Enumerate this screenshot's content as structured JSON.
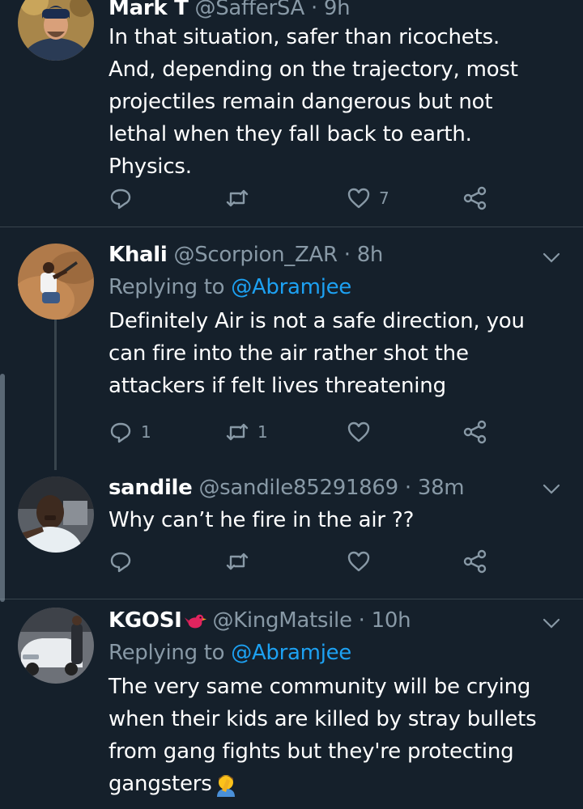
{
  "tweets": [
    {
      "name": "Mark T",
      "handle": "@SafferSA",
      "time": "9h",
      "lines": [
        "In that situation, safer than ricochets.",
        "And, depending on the trajectory, most",
        "projectiles remain dangerous but not",
        "lethal when they fall back to earth.",
        "Physics."
      ],
      "replies": "",
      "retweets": "",
      "likes": "7"
    },
    {
      "name": "Khali",
      "handle": "@Scorpion_ZAR",
      "time": "8h",
      "replying_label": "Replying to",
      "replying_to": "@Abramjee",
      "lines": [
        "Definitely Air is not a safe direction, you",
        "can fire into the air rather shot the",
        "attackers if felt lives threatening"
      ],
      "replies": "1",
      "retweets": "1",
      "likes": ""
    },
    {
      "name": "sandile",
      "handle": "@sandile85291869",
      "time": "38m",
      "lines": [
        "Why can’t he fire in the air ??"
      ],
      "replies": "",
      "retweets": "",
      "likes": ""
    },
    {
      "name": "KGOSI",
      "name_emoji": "red-bird-emoji",
      "handle": "@KingMatsile",
      "time": "10h",
      "replying_label": "Replying to",
      "replying_to": "@Abramjee",
      "lines": [
        "The very same community will be crying",
        "when their kids are killed by stray bullets",
        "from gang fights but they're protecting",
        "gangsters"
      ],
      "line_emoji": "person-facepalming-emoji"
    }
  ],
  "separator": " · ",
  "colors": {
    "background": "#15202b",
    "secondary_text": "#8899a6",
    "link": "#1da1f2",
    "divider": "#38444d"
  },
  "icons": [
    "reply-icon",
    "retweet-icon",
    "like-icon",
    "share-icon",
    "chevron-down-icon"
  ]
}
